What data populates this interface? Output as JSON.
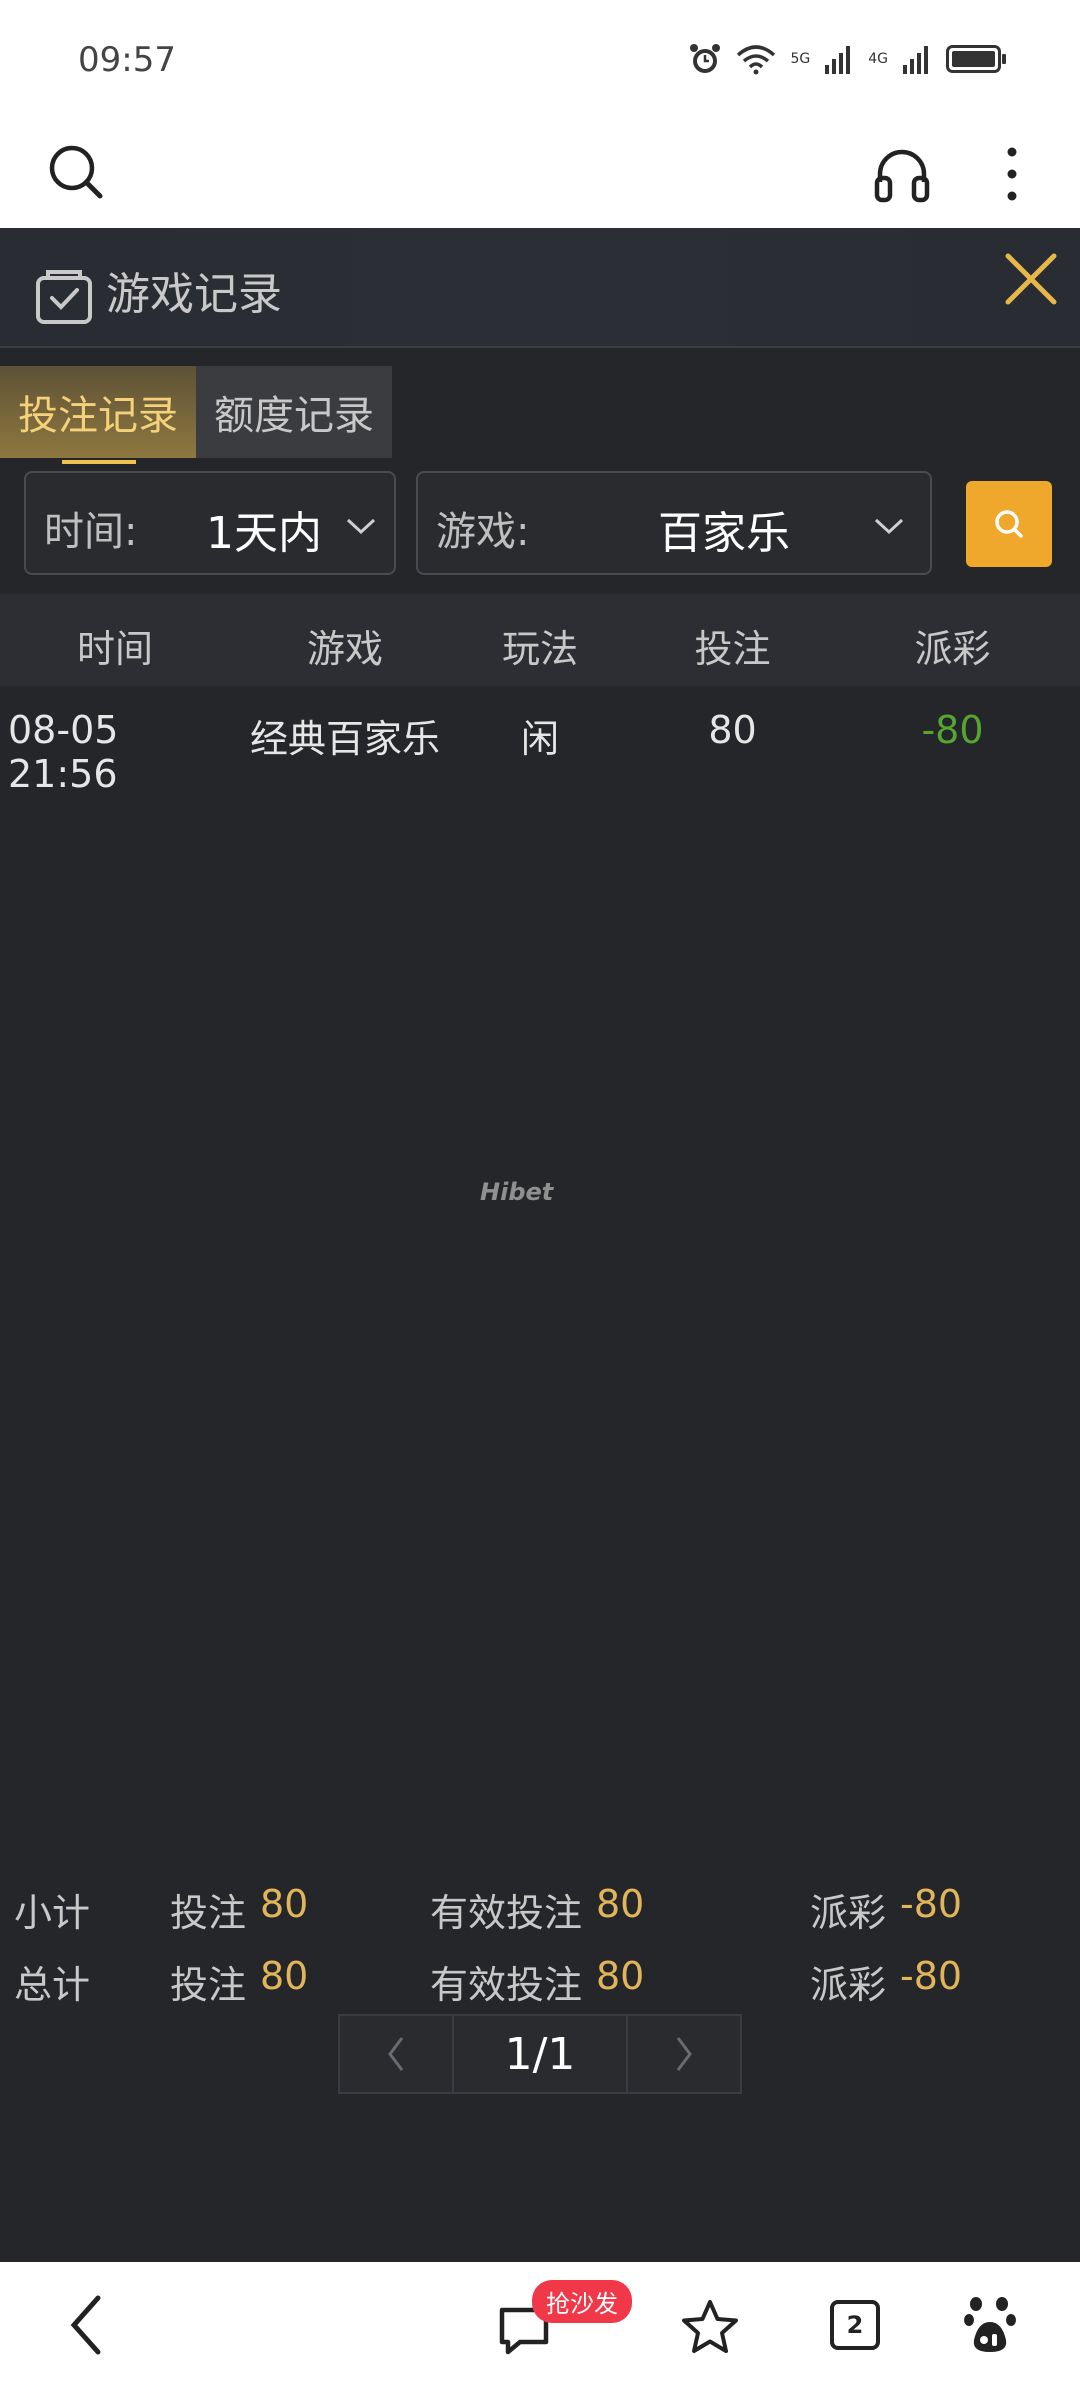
{
  "status_bar": {
    "time": "09:57",
    "net1": "5G",
    "net2": "4G"
  },
  "panel": {
    "title": "游戏记录",
    "tabs": [
      {
        "label": "投注记录",
        "active": true
      },
      {
        "label": "额度记录",
        "active": false
      }
    ],
    "filters": {
      "time_label": "时间:",
      "time_value": "1天内",
      "game_label": "游戏:",
      "game_value": "百家乐"
    },
    "table": {
      "columns": [
        "时间",
        "游戏",
        "玩法",
        "投注",
        "派彩"
      ],
      "rows": [
        {
          "time": "08-05 21:56",
          "game": "经典百家乐",
          "play": "闲",
          "bet": "80",
          "payout": "-80"
        }
      ]
    },
    "watermark": "Hibet",
    "pagination": {
      "current": "1/1"
    },
    "subtotal": {
      "label": "小计",
      "bet_label": "投注",
      "bet": "80",
      "valid_label": "有效投注",
      "valid": "80",
      "payout_label": "派彩",
      "payout": "-80"
    },
    "total": {
      "label": "总计",
      "bet_label": "投注",
      "bet": "80",
      "valid_label": "有效投注",
      "valid": "80",
      "payout_label": "派彩",
      "payout": "-80"
    }
  },
  "bottom_bar": {
    "comment_badge": "抢沙发",
    "tab_count": "2"
  },
  "colors": {
    "accent": "#f0a82c",
    "panel_bg": "#25262a",
    "gold_text": "#e3b55a",
    "negative": "#55a530"
  }
}
